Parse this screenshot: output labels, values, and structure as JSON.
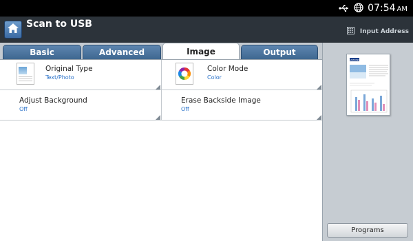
{
  "status_bar": {
    "time": "07:54",
    "ampm": "AM",
    "icons": [
      "usb-icon",
      "globe-icon"
    ]
  },
  "header": {
    "title": "Scan to USB",
    "home_icon": "home-icon",
    "input_address_label": "Input Address",
    "input_address_icon": "keypad-icon"
  },
  "tabs": [
    {
      "label": "Basic",
      "active": false
    },
    {
      "label": "Advanced",
      "active": false
    },
    {
      "label": "Image",
      "active": true
    },
    {
      "label": "Output",
      "active": false
    }
  ],
  "options": [
    {
      "title": "Original Type",
      "value": "Text/Photo",
      "icon": "document-icon"
    },
    {
      "title": "Color Mode",
      "value": "Color",
      "icon": "color-wheel-icon"
    },
    {
      "title": "Adjust Background",
      "value": "Off"
    },
    {
      "title": "Erase Backside Image",
      "value": "Off"
    }
  ],
  "sidebar": {
    "preview_brand": "SAMSUNG",
    "programs_label": "Programs"
  },
  "colors": {
    "header_bg": "#2c333a",
    "tab_blue": "#4f79a4",
    "value_blue": "#2a72c9",
    "sidebar_bg": "#c6ccd2"
  }
}
